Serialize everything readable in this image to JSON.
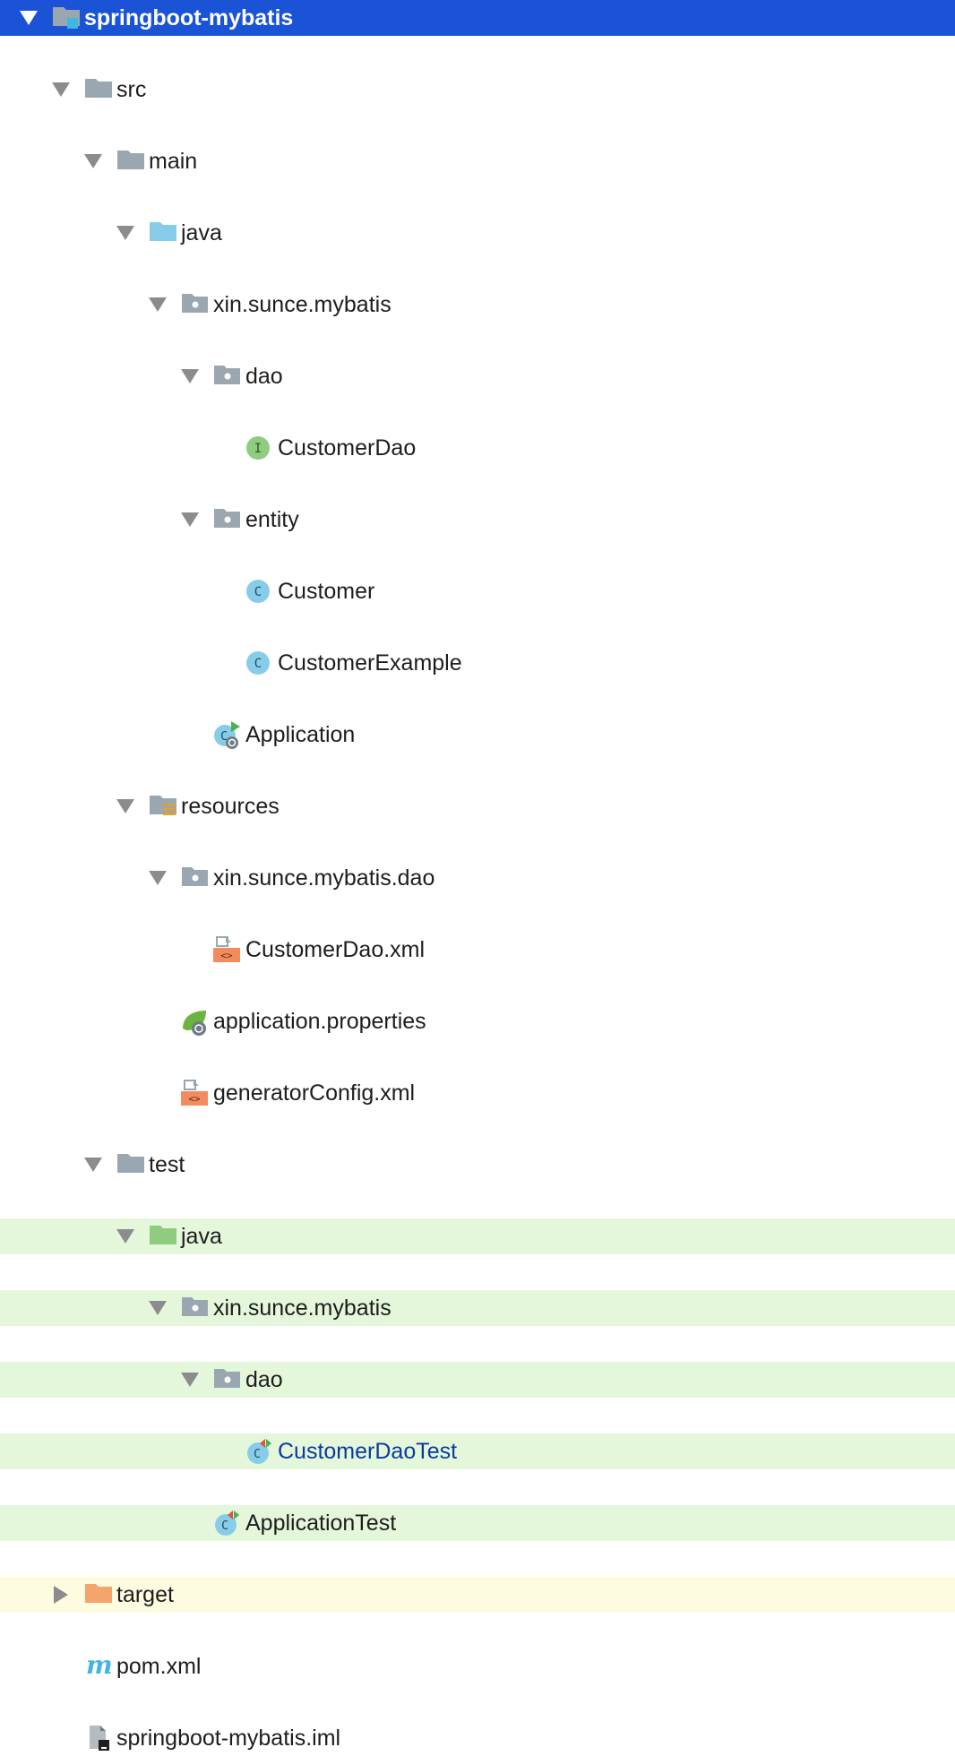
{
  "project_tree": {
    "root": "springboot-mybatis",
    "src": "src",
    "main": "main",
    "main_java": "java",
    "main_pkg": "xin.sunce.mybatis",
    "dao": "dao",
    "customer_dao": "CustomerDao",
    "entity": "entity",
    "customer": "Customer",
    "customer_example": "CustomerExample",
    "application": "Application",
    "resources": "resources",
    "res_pkg": "xin.sunce.mybatis.dao",
    "customer_dao_xml": "CustomerDao.xml",
    "app_props": "application.properties",
    "generator_config": "generatorConfig.xml",
    "test": "test",
    "test_java": "java",
    "test_pkg": "xin.sunce.mybatis",
    "test_dao": "dao",
    "customer_dao_test": "CustomerDaoTest",
    "application_test": "ApplicationTest",
    "target": "target",
    "pom": "pom.xml",
    "iml": "springboot-mybatis.iml"
  },
  "icons": {
    "root": "module-folder-icon",
    "src": "folder-icon",
    "main": "folder-icon",
    "main_java": "source-root-folder-icon",
    "package": "package-icon",
    "interface": "interface-icon",
    "class": "class-icon",
    "spring_boot_app": "spring-boot-class-icon",
    "resources": "resources-folder-icon",
    "xml": "xml-file-icon",
    "spring_properties": "spring-properties-icon",
    "test_java": "test-source-root-icon",
    "test_class": "test-class-icon",
    "excluded_folder": "excluded-folder-icon",
    "maven": "maven-icon",
    "iml": "iml-file-icon"
  },
  "colors": {
    "selection": "#1a53d5",
    "test_background": "#e4f7da",
    "excluded_background": "#fdfce0",
    "modified_text": "#0b3a9e"
  }
}
